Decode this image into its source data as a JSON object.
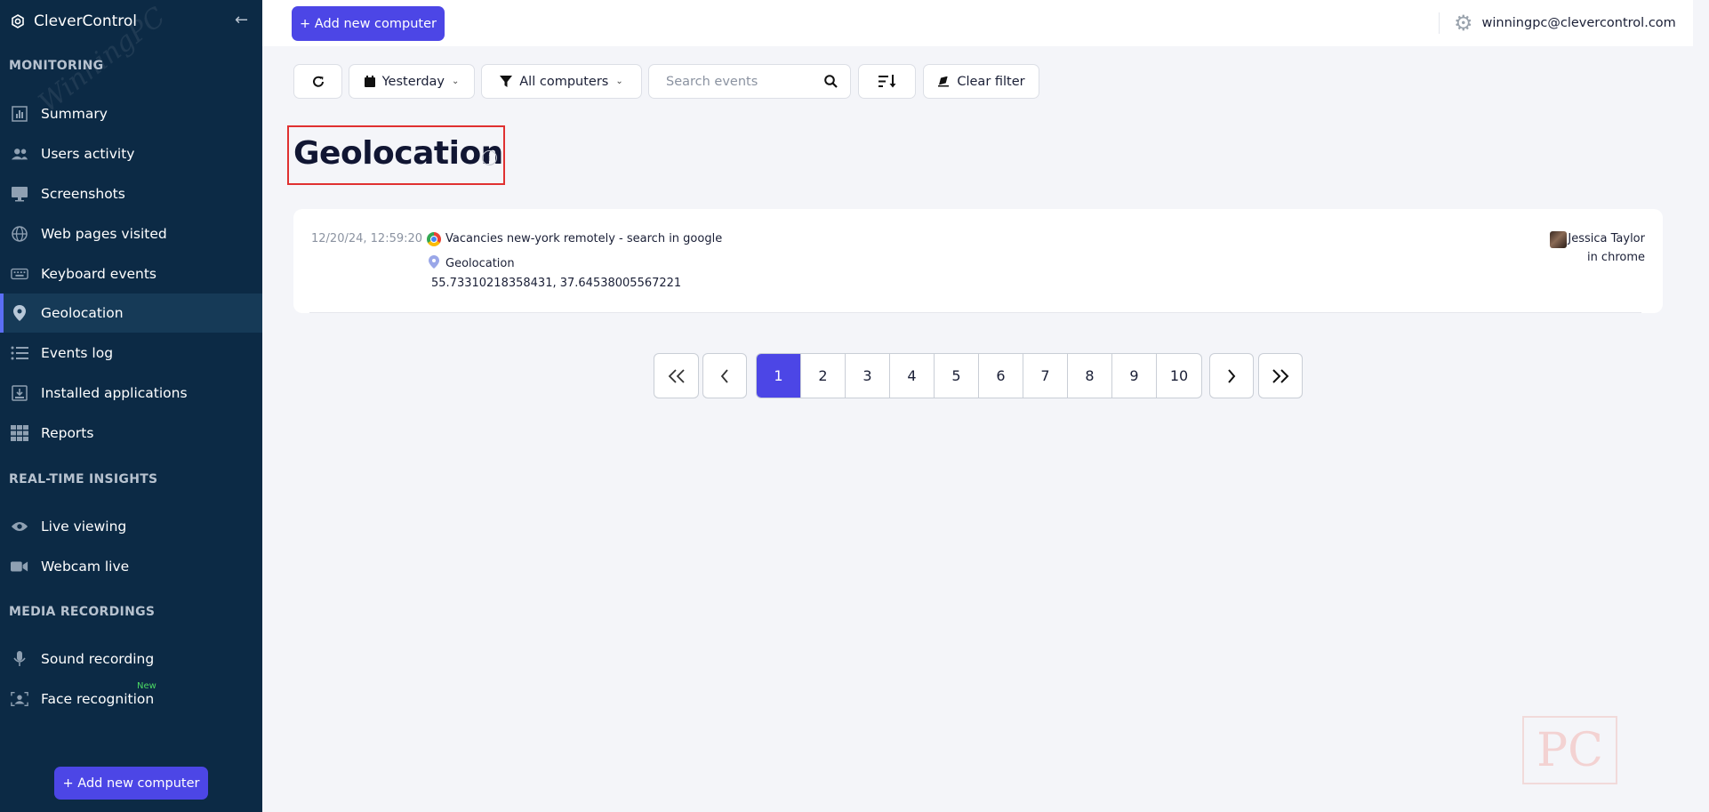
{
  "app": {
    "name": "CleverControl"
  },
  "sidebar": {
    "sections": {
      "monitoring": "MONITORING",
      "realtime": "REAL-TIME INSIGHTS",
      "media": "MEDIA RECORDINGS"
    },
    "items": [
      {
        "label": "Summary",
        "icon": "bar-chart-icon"
      },
      {
        "label": "Users activity",
        "icon": "users-icon"
      },
      {
        "label": "Screenshots",
        "icon": "monitor-icon"
      },
      {
        "label": "Web pages visited",
        "icon": "globe-icon"
      },
      {
        "label": "Keyboard events",
        "icon": "keyboard-icon"
      },
      {
        "label": "Geolocation",
        "icon": "map-pin-icon",
        "active": true
      },
      {
        "label": "Events log",
        "icon": "list-icon"
      },
      {
        "label": "Installed applications",
        "icon": "download-box-icon"
      },
      {
        "label": "Reports",
        "icon": "grid-icon"
      },
      {
        "label": "Live viewing",
        "icon": "eye-icon"
      },
      {
        "label": "Webcam live",
        "icon": "video-camera-icon"
      },
      {
        "label": "Sound recording",
        "icon": "microphone-icon"
      },
      {
        "label": "Face recognition",
        "icon": "face-scan-icon",
        "badge": "New"
      }
    ],
    "add_button": "+ Add new computer"
  },
  "topbar": {
    "add_button": "+ Add new computer",
    "user_email": "winningpc@clevercontrol.com"
  },
  "filters": {
    "date": "Yesterday",
    "computers": "All computers",
    "search_placeholder": "Search events",
    "clear": "Clear filter"
  },
  "page": {
    "title": "Geolocation"
  },
  "event": {
    "time": "12/20/24, 12:59:20",
    "title": "Vacancies new-york remotely - search in google",
    "type": "Geolocation",
    "coords": "55.73310218358431, 37.64538005567221",
    "user": "Jessica Taylor",
    "app": "in chrome"
  },
  "pagination": {
    "pages": [
      "1",
      "2",
      "3",
      "4",
      "5",
      "6",
      "7",
      "8",
      "9",
      "10"
    ],
    "current": "1"
  },
  "colors": {
    "sidebar_bg": "#0c2a45",
    "accent": "#4c46e6",
    "highlight_border": "#e03131"
  }
}
